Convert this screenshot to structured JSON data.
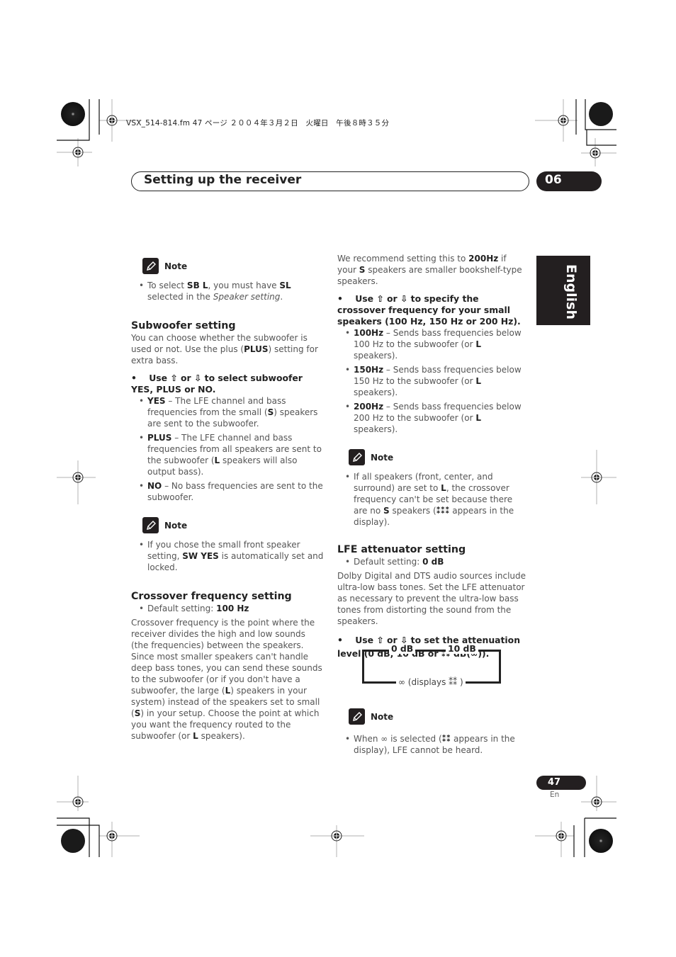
{
  "print_slug": "VSX_514-814.fm  47 ページ  ２００４年３月２日　火曜日　午後８時３５分",
  "header": {
    "title": "Setting up the receiver",
    "chapter": "06"
  },
  "language_tab": "English",
  "note_label": "Note",
  "left_column": {
    "note1": {
      "prefix": "To select ",
      "b1": "SB L",
      "mid": ", you must have ",
      "b2": "SL",
      "suffix": " selected in the ",
      "italic": "Speaker setting",
      "end": "."
    },
    "subwoofer": {
      "heading": "Subwoofer setting",
      "intro_a": "You can choose whether the subwoofer is used or not. Use the plus (",
      "intro_b": "PLUS",
      "intro_c": ") setting for extra bass.",
      "step": "Use ⇧ or ⇩ to select subwoofer YES, PLUS or NO.",
      "options": [
        {
          "key": "YES",
          "text_a": " – The LFE channel and bass frequencies from the small (",
          "bold": "S",
          "text_b": ") speakers are sent to the subwoofer."
        },
        {
          "key": "PLUS",
          "text_a": " – The LFE channel and bass frequencies from all speakers are sent to the subwoofer (",
          "bold": "L",
          "text_b": " speakers will also output bass)."
        },
        {
          "key": "NO",
          "text_a": " – No bass frequencies are sent to the subwoofer.",
          "bold": "",
          "text_b": ""
        }
      ]
    },
    "note2": {
      "prefix": "If you chose the small front speaker setting, ",
      "bold": "SW YES",
      "suffix": " is automatically set and locked."
    },
    "crossover": {
      "heading": "Crossover frequency setting",
      "default_prefix": "Default setting: ",
      "default_value": "100 Hz",
      "body_a": "Crossover frequency is the point where the receiver divides the high and low sounds (the frequencies) between the speakers. Since most smaller speakers can't handle deep bass tones, you can send these sounds to the subwoofer (or if you don't have a subwoofer, the large (",
      "body_b": "L",
      "body_c": ") speakers in your system) instead of the speakers set to small (",
      "body_d": "S",
      "body_e": ") in your setup. Choose the point at which you want the frequency routed to the subwoofer (or ",
      "body_f": "L",
      "body_g": " speakers)."
    }
  },
  "right_column": {
    "recommend_a": "We recommend setting this to ",
    "recommend_b": "200Hz",
    "recommend_c": " if your ",
    "recommend_d": "S",
    "recommend_e": " speakers are smaller bookshelf-type speakers.",
    "step": "Use ⇧ or ⇩ to specify the crossover frequency for your small speakers (100 Hz, 150 Hz or 200 Hz).",
    "options": [
      {
        "key": "100Hz",
        "text_a": " – Sends bass frequencies below 100 Hz to the subwoofer (or ",
        "bold": "L",
        "text_b": " speakers)."
      },
      {
        "key": "150Hz",
        "text_a": " – Sends bass frequencies below 150 Hz to the subwoofer (or ",
        "bold": "L",
        "text_b": " speakers)."
      },
      {
        "key": "200Hz",
        "text_a": " – Sends bass frequencies below 200 Hz to the subwoofer (or ",
        "bold": "L",
        "text_b": " speakers)."
      }
    ],
    "note3": {
      "a": "If all speakers (front, center, and surround) are set to ",
      "b": "L",
      "c": ", the crossover frequency can't be set because there are no ",
      "d": "S",
      "e": " speakers (",
      "glyph": "⁑⁑⁑",
      "f": " appears in the display)."
    },
    "lfe": {
      "heading": "LFE attenuator setting",
      "default_prefix": "Default setting: ",
      "default_value": "0 dB",
      "body": "Dolby Digital and DTS audio sources include ultra-low bass tones. Set the LFE attenuator as necessary to prevent the ultra-low bass tones from distorting the sound from the speakers.",
      "step": "Use ⇧ or ⇩ to set the attenuation level (0 dB, 10 dB or ⁑⁑ dB(∞)).",
      "diagram": {
        "first": "0 dB",
        "second": "10 dB",
        "bottom": "∞ (displays ⁑⁑ )"
      }
    },
    "note4": {
      "a": "When ∞ is selected (",
      "glyph": "⁑⁑",
      "b": " appears in the display), LFE cannot be heard."
    }
  },
  "footer": {
    "page": "47",
    "lang": "En"
  }
}
